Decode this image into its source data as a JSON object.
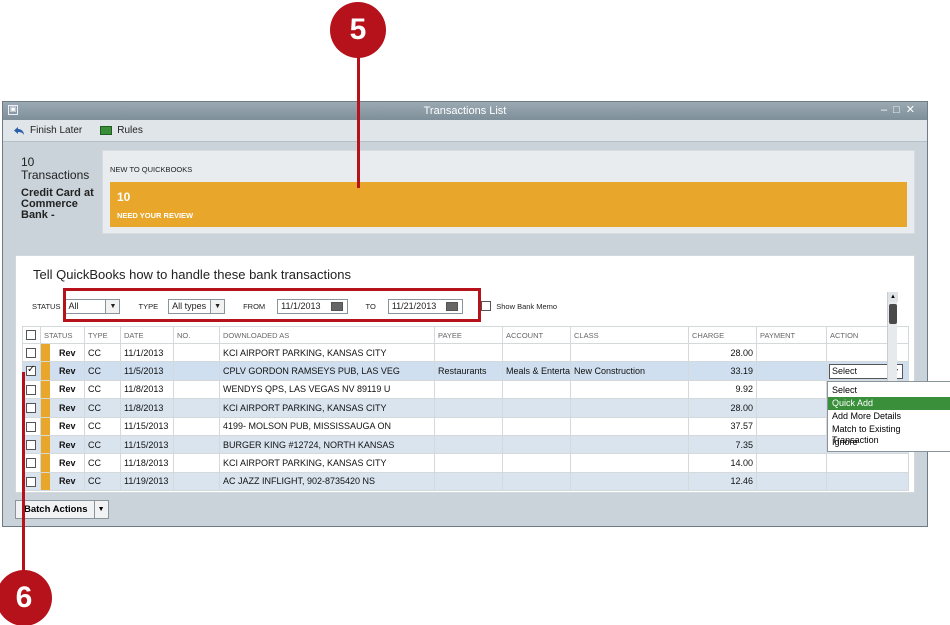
{
  "callouts": {
    "top": "5",
    "bottom": "6"
  },
  "window": {
    "title": "Transactions List"
  },
  "toolbar": {
    "finish_later": "Finish Later",
    "rules": "Rules"
  },
  "account": {
    "count_line1": "10",
    "count_line2": "Transactions",
    "name": "Credit Card at Commerce Bank -"
  },
  "new_to_qb": {
    "header": "NEW TO QUICKBOOKS",
    "count": "10",
    "label": "NEED YOUR REVIEW"
  },
  "panel": {
    "heading": "Tell QuickBooks how to handle these bank transactions"
  },
  "filters": {
    "status_label": "STATUS",
    "status_value": "All",
    "type_label": "TYPE",
    "type_value": "All types",
    "from_label": "FROM",
    "from_value": "11/1/2013",
    "to_label": "TO",
    "to_value": "11/21/2013",
    "show_memo": "Show Bank Memo"
  },
  "columns": [
    "STATUS",
    "TYPE",
    "DATE",
    "NO.",
    "DOWNLOADED AS",
    "PAYEE",
    "ACCOUNT",
    "CLASS",
    "CHARGE",
    "PAYMENT",
    "ACTION"
  ],
  "rows": [
    {
      "checked": false,
      "status": "Rev",
      "type": "CC",
      "date": "11/1/2013",
      "no": "",
      "downloaded": "KCI AIRPORT PARKING, KANSAS CITY",
      "payee": "",
      "account": "",
      "class": "",
      "charge": "28.00",
      "payment": "",
      "action": ""
    },
    {
      "checked": true,
      "status": "Rev",
      "type": "CC",
      "date": "11/5/2013",
      "no": "",
      "downloaded": "CPLV GORDON RAMSEYS PUB, LAS VEG",
      "payee": "Restaurants",
      "account": "Meals & Entertai",
      "class": "New Construction",
      "charge": "33.19",
      "payment": "",
      "action": "Select"
    },
    {
      "checked": false,
      "status": "Rev",
      "type": "CC",
      "date": "11/8/2013",
      "no": "",
      "downloaded": "WENDYS QPS, LAS VEGAS NV 89119 U",
      "payee": "",
      "account": "",
      "class": "",
      "charge": "9.92",
      "payment": "",
      "action": ""
    },
    {
      "checked": false,
      "status": "Rev",
      "type": "CC",
      "date": "11/8/2013",
      "no": "",
      "downloaded": "KCI AIRPORT PARKING, KANSAS CITY",
      "payee": "",
      "account": "",
      "class": "",
      "charge": "28.00",
      "payment": "",
      "action": ""
    },
    {
      "checked": false,
      "status": "Rev",
      "type": "CC",
      "date": "11/15/2013",
      "no": "",
      "downloaded": "4199- MOLSON PUB, MISSISSAUGA ON",
      "payee": "",
      "account": "",
      "class": "",
      "charge": "37.57",
      "payment": "",
      "action": ""
    },
    {
      "checked": false,
      "status": "Rev",
      "type": "CC",
      "date": "11/15/2013",
      "no": "",
      "downloaded": "BURGER KING #12724, NORTH KANSAS",
      "payee": "",
      "account": "",
      "class": "",
      "charge": "7.35",
      "payment": "",
      "action": ""
    },
    {
      "checked": false,
      "status": "Rev",
      "type": "CC",
      "date": "11/18/2013",
      "no": "",
      "downloaded": "KCI AIRPORT PARKING, KANSAS CITY",
      "payee": "",
      "account": "",
      "class": "",
      "charge": "14.00",
      "payment": "",
      "action": ""
    },
    {
      "checked": false,
      "status": "Rev",
      "type": "CC",
      "date": "11/19/2013",
      "no": "",
      "downloaded": "AC JAZZ INFLIGHT, 902-8735420 NS",
      "payee": "",
      "account": "",
      "class": "",
      "charge": "12.46",
      "payment": "",
      "action": ""
    }
  ],
  "action_menu": [
    "Select",
    "Quick Add",
    "Add More Details",
    "Match to Existing Transaction",
    "Ignore"
  ],
  "action_menu_active": "Quick Add",
  "batch": {
    "label": "Batch Actions"
  },
  "colors": {
    "accent": "#e8a72a",
    "callout": "#b5121b",
    "menu_active": "#3a8f3a"
  }
}
